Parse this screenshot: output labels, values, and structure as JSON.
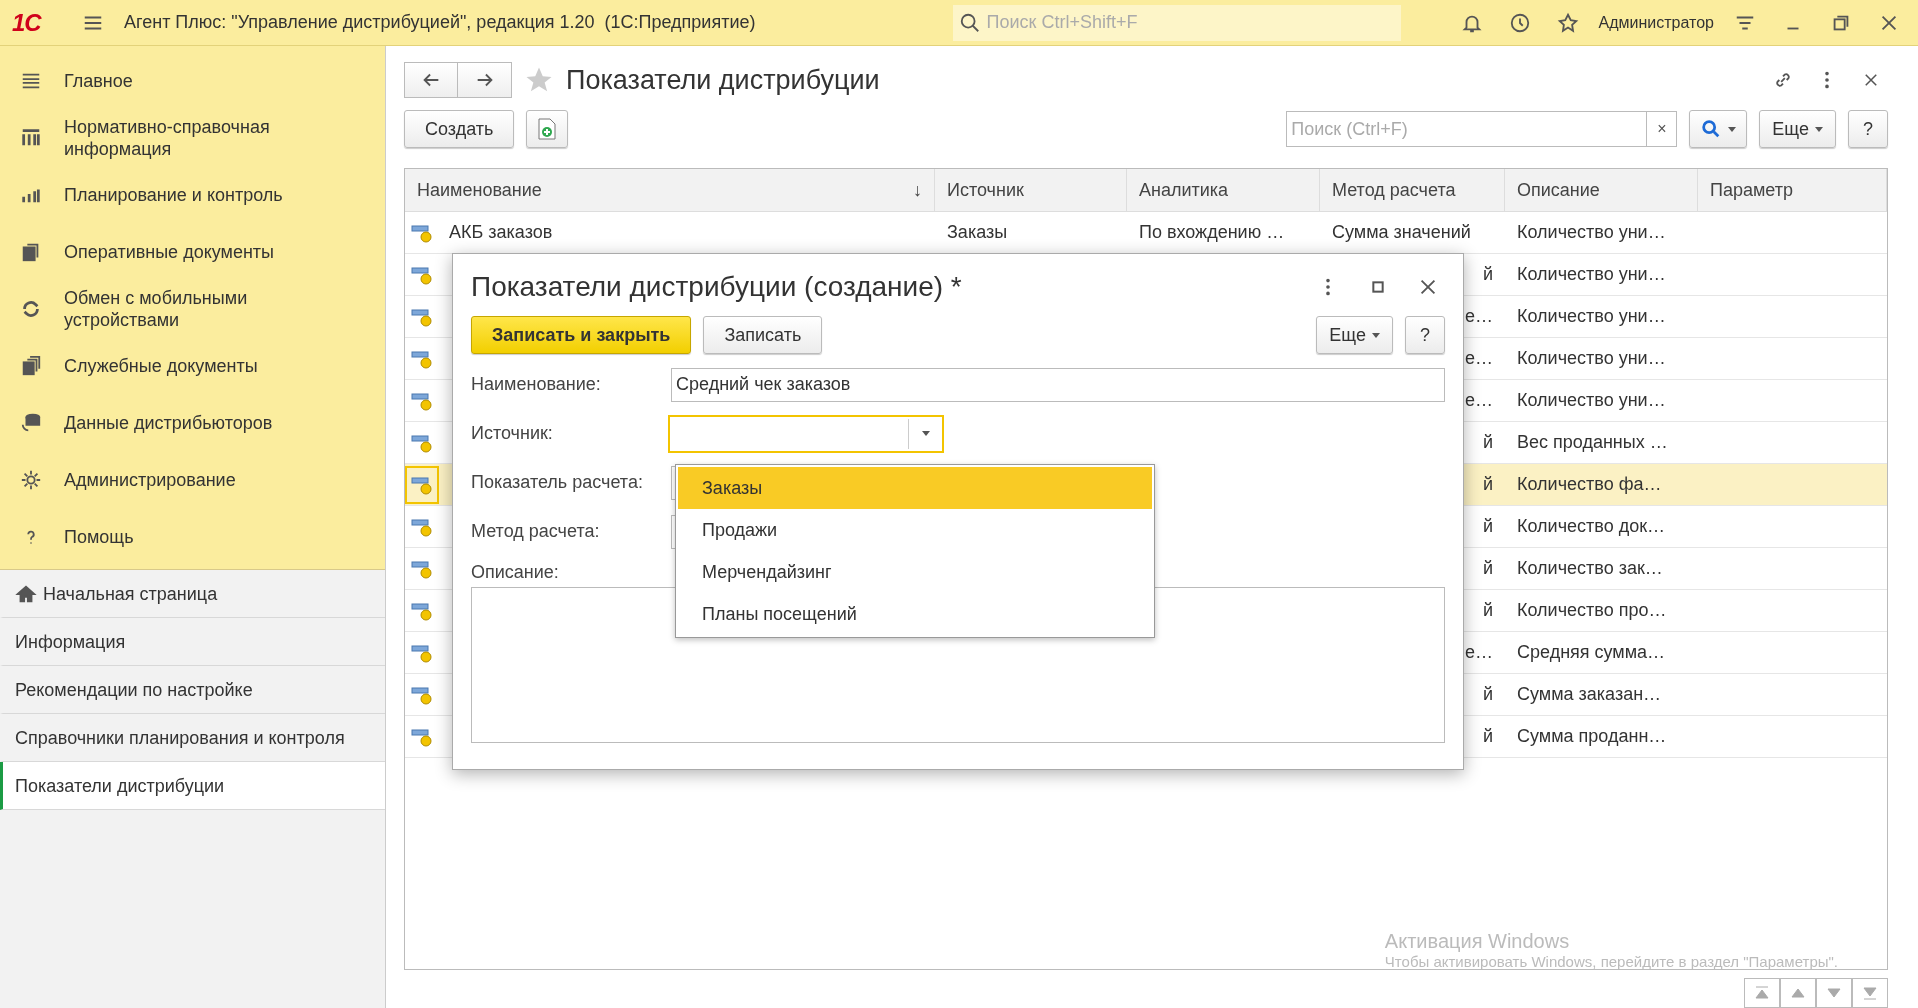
{
  "app_bar": {
    "logo": "1С",
    "title": "Агент Плюс: \"Управление дистрибуцией\", редакция 1.20  (1С:Предприятие)",
    "search": {
      "placeholder": "Поиск Ctrl+Shift+F"
    },
    "user": "Администратор"
  },
  "sidebar": {
    "sections": [
      {
        "label": "Главное"
      },
      {
        "label": "Нормативно-справочная информация"
      },
      {
        "label": "Планирование и контроль"
      },
      {
        "label": "Оперативные документы"
      },
      {
        "label": "Обмен с мобильными устройствами"
      },
      {
        "label": "Служебные документы"
      },
      {
        "label": "Данные дистрибьюторов"
      },
      {
        "label": "Администрирование"
      },
      {
        "label": "Помощь"
      }
    ],
    "open_pages": [
      {
        "label": "Начальная страница",
        "kind": "home",
        "selected": false
      },
      {
        "label": "Информация",
        "kind": "page",
        "selected": false
      },
      {
        "label": "Рекомендации по настройке",
        "kind": "page",
        "selected": false
      },
      {
        "label": "Справочники планирования и контроля",
        "kind": "page",
        "selected": false
      },
      {
        "label": "Показатели дистрибуции",
        "kind": "page",
        "selected": true
      }
    ]
  },
  "page": {
    "title": "Показатели дистрибуции",
    "create_button": "Создать",
    "search": {
      "placeholder": "Поиск (Ctrl+F)"
    },
    "clear_button": "×",
    "more_button": "Еще",
    "help_button": "?"
  },
  "table": {
    "columns": [
      {
        "label": "Наименование",
        "sort": "↓"
      },
      {
        "label": "Источник"
      },
      {
        "label": "Аналитика"
      },
      {
        "label": "Метод расчета"
      },
      {
        "label": "Описание"
      },
      {
        "label": "Параметр"
      }
    ],
    "rows": [
      {
        "name": "АКБ заказов",
        "source": "Заказы",
        "analytics": "По вхождению …",
        "method": "Сумма значений",
        "description": "Количество уни…",
        "selected": false
      },
      {
        "method": "й",
        "description": "Количество уни…",
        "selected": false
      },
      {
        "method": "е…",
        "description": "Количество уни…",
        "selected": false
      },
      {
        "method": "е…",
        "description": "Количество уни…",
        "selected": false
      },
      {
        "method": "е…",
        "description": "Количество уни…",
        "selected": false
      },
      {
        "method": "й",
        "description": "Вес проданных …",
        "selected": false
      },
      {
        "method": "й",
        "description": "Количество фа…",
        "selected": true
      },
      {
        "method": "й",
        "description": "Количество док…",
        "selected": false
      },
      {
        "method": "й",
        "description": "Количество зак…",
        "selected": false
      },
      {
        "method": "й",
        "description": "Количество про…",
        "selected": false
      },
      {
        "method": "е…",
        "description": "Средняя сумма…",
        "selected": false
      },
      {
        "method": "й",
        "description": "Сумма заказан…",
        "selected": false
      },
      {
        "method": "й",
        "description": "Сумма проданн…",
        "selected": false
      }
    ]
  },
  "dialog": {
    "title": "Показатели дистрибуции (создание) *",
    "save_close_button": "Записать и закрыть",
    "save_button": "Записать",
    "more_button": "Еще",
    "help_button": "?",
    "fields": [
      {
        "label": "Наименование:",
        "kind": "text",
        "value": "Средний чек заказов"
      },
      {
        "label": "Источник:",
        "kind": "combo",
        "focused": true
      },
      {
        "label": "Показатель расчета:",
        "kind": "covered"
      },
      {
        "label": "Метод расчета:",
        "kind": "covered"
      }
    ],
    "description_label": "Описание:",
    "dropdown": [
      {
        "label": "Заказы",
        "selected": true
      },
      {
        "label": "Продажи",
        "selected": false
      },
      {
        "label": "Мерчендайзинг",
        "selected": false
      },
      {
        "label": "Планы посещений",
        "selected": false
      }
    ]
  },
  "os_notice": {
    "title": "Активация Windows",
    "text": "Чтобы активировать Windows, перейдите в раздел \"Параметры\"."
  }
}
